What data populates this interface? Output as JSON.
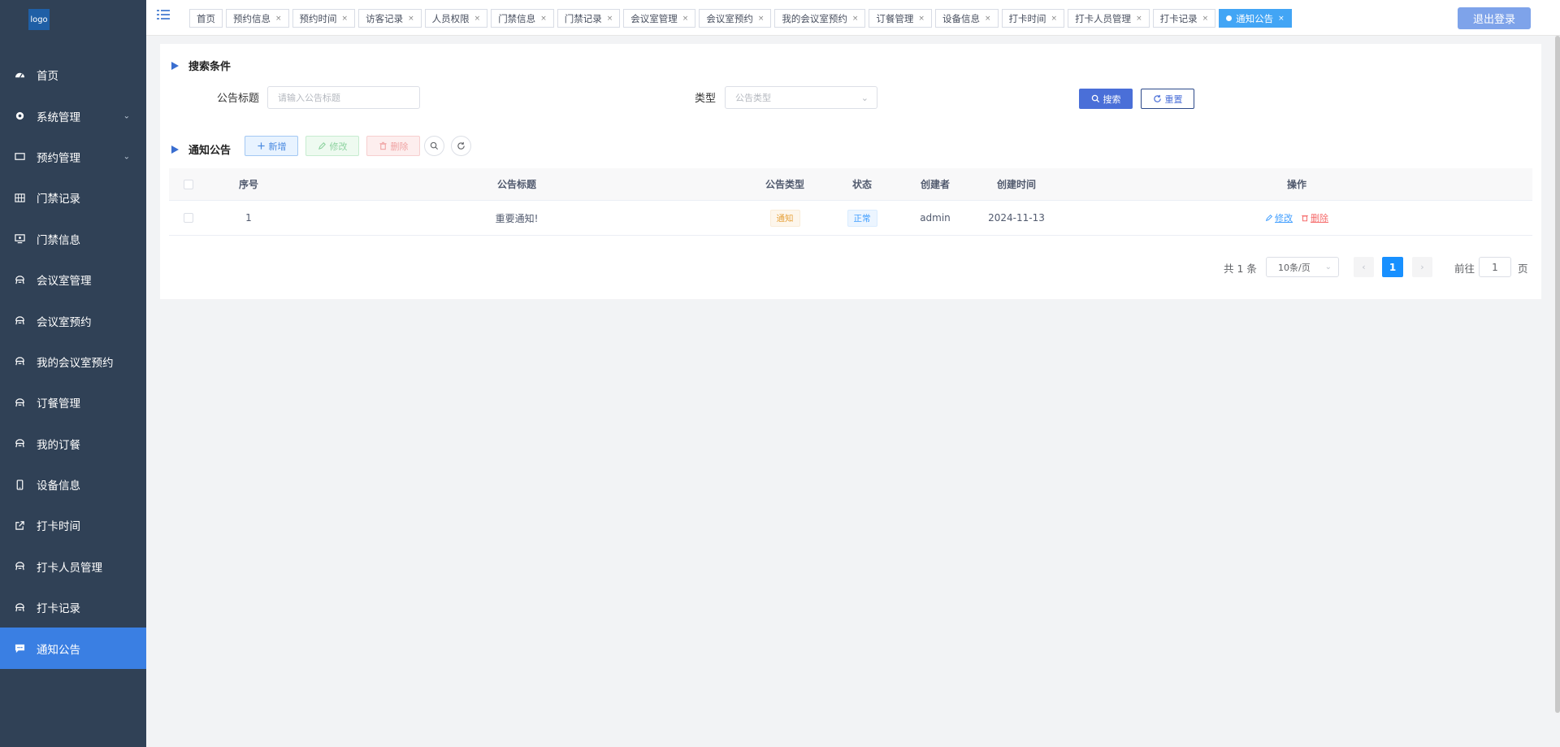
{
  "logo": {
    "text": "logo"
  },
  "sidebar": {
    "items": [
      {
        "label": "首页",
        "icon": "dashboard-icon",
        "has_arrow": false
      },
      {
        "label": "系统管理",
        "icon": "gear-icon",
        "has_arrow": true
      },
      {
        "label": "预约管理",
        "icon": "card-icon",
        "has_arrow": true
      },
      {
        "label": "门禁记录",
        "icon": "table-icon",
        "has_arrow": false
      },
      {
        "label": "门禁信息",
        "icon": "monitor-icon",
        "has_arrow": false
      },
      {
        "label": "会议室管理",
        "icon": "guide-icon",
        "has_arrow": false
      },
      {
        "label": "会议室预约",
        "icon": "guide-icon",
        "has_arrow": false
      },
      {
        "label": "我的会议室预约",
        "icon": "guide-icon",
        "has_arrow": false
      },
      {
        "label": "订餐管理",
        "icon": "guide-icon",
        "has_arrow": false
      },
      {
        "label": "我的订餐",
        "icon": "guide-icon",
        "has_arrow": false
      },
      {
        "label": "设备信息",
        "icon": "phone-icon",
        "has_arrow": false
      },
      {
        "label": "打卡时间",
        "icon": "external-link-icon",
        "has_arrow": false
      },
      {
        "label": "打卡人员管理",
        "icon": "guide-icon",
        "has_arrow": false
      },
      {
        "label": "打卡记录",
        "icon": "guide-icon",
        "has_arrow": false
      },
      {
        "label": "通知公告",
        "icon": "message-icon",
        "has_arrow": false,
        "active": true
      }
    ]
  },
  "tags": [
    {
      "label": "首页",
      "closable": false
    },
    {
      "label": "预约信息",
      "closable": true
    },
    {
      "label": "预约时间",
      "closable": true
    },
    {
      "label": "访客记录",
      "closable": true
    },
    {
      "label": "人员权限",
      "closable": true
    },
    {
      "label": "门禁信息",
      "closable": true
    },
    {
      "label": "门禁记录",
      "closable": true
    },
    {
      "label": "会议室管理",
      "closable": true
    },
    {
      "label": "会议室预约",
      "closable": true
    },
    {
      "label": "我的会议室预约",
      "closable": true
    },
    {
      "label": "订餐管理",
      "closable": true
    },
    {
      "label": "设备信息",
      "closable": true
    },
    {
      "label": "打卡时间",
      "closable": true
    },
    {
      "label": "打卡人员管理",
      "closable": true
    },
    {
      "label": "打卡记录",
      "closable": true
    },
    {
      "label": "通知公告",
      "closable": true,
      "active": true
    }
  ],
  "header": {
    "logout_label": "退出登录"
  },
  "search": {
    "section_title": "搜索条件",
    "title_label": "公告标题",
    "title_placeholder": "请输入公告标题",
    "type_label": "类型",
    "type_placeholder": "公告类型",
    "search_label": "搜索",
    "reset_label": "重置"
  },
  "toolbar": {
    "section_title": "通知公告",
    "add_label": "新增",
    "edit_label": "修改",
    "delete_label": "删除"
  },
  "table": {
    "columns": [
      "序号",
      "公告标题",
      "公告类型",
      "状态",
      "创建者",
      "创建时间",
      "操作"
    ],
    "rows": [
      {
        "index": "1",
        "title": "重要通知!",
        "type": "通知",
        "status": "正常",
        "creator": "admin",
        "created": "2024-11-13",
        "edit": "修改",
        "delete": "删除"
      }
    ]
  },
  "pagination": {
    "total": "共 1 条",
    "page_size": "10条/页",
    "current": "1",
    "goto_label": "前往",
    "goto_value": "1",
    "page_suffix": "页"
  },
  "colors": {
    "sidebar_bg": "#304156",
    "active_menu": "#3a7fe3",
    "primary": "#4a6fd8",
    "active_tag": "#42a5f5"
  }
}
